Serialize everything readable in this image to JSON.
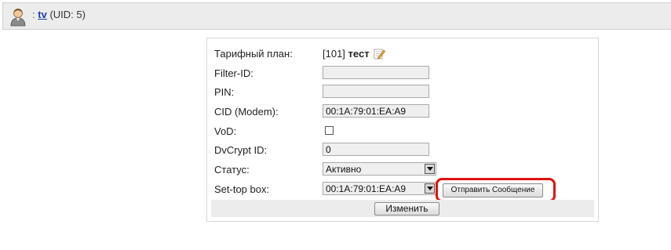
{
  "user": {
    "separator": ":",
    "login": "tv",
    "uid_text": "(UID: 5)"
  },
  "form": {
    "tariff_label": "Тарифный план:",
    "tariff_code": "[101]",
    "tariff_name": "тест",
    "filter_id_label": "Filter-ID:",
    "filter_id_value": "",
    "pin_label": "PIN:",
    "pin_value": "",
    "cid_label": "CID (Modem):",
    "cid_value": "00:1A:79:01:EA:A9",
    "vod_label": "VoD:",
    "vod_checked": false,
    "dvcrypt_label": "DvCrypt ID:",
    "dvcrypt_value": "0",
    "status_label": "Статус:",
    "status_value": "Активно",
    "stb_label": "Set-top box:",
    "stb_value": "00:1A:79:01:EA:A9",
    "send_message_label": "Отправить Сообщение",
    "submit_label": "Изменить"
  },
  "colors": {
    "highlight": "#e01010",
    "link": "#1a3fa8"
  }
}
